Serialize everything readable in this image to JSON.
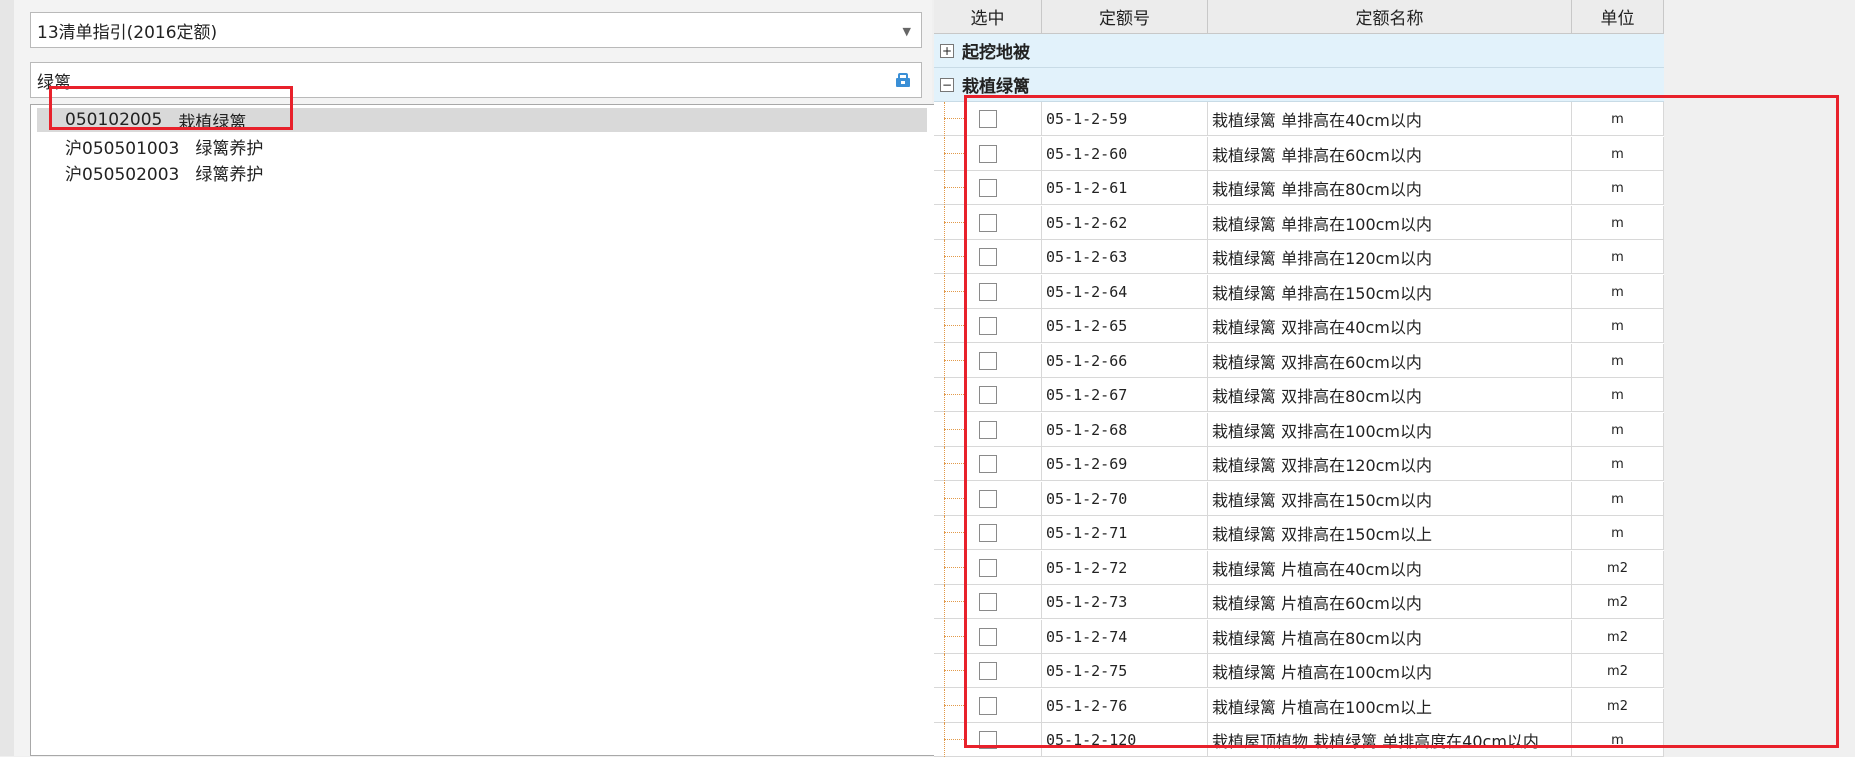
{
  "left": {
    "combo_value": "13清单指引(2016定额)",
    "search_value": "绿篱",
    "tree": [
      {
        "code": "050102005",
        "name": "栽植绿篱"
      },
      {
        "code": "沪050501003",
        "name": "绿篱养护"
      },
      {
        "code": "沪050502003",
        "name": "绿篱养护"
      }
    ]
  },
  "grid": {
    "headers": {
      "select": "选中",
      "code": "定额号",
      "name": "定额名称",
      "unit": "单位"
    },
    "groups": {
      "g1": {
        "toggle": "+",
        "label": "起挖地被"
      },
      "g2": {
        "toggle": "−",
        "label": "栽植绿篱"
      }
    },
    "rows": [
      {
        "code": "05-1-2-59",
        "name": "栽植绿篱 单排高在40cm以内",
        "unit": "m"
      },
      {
        "code": "05-1-2-60",
        "name": "栽植绿篱 单排高在60cm以内",
        "unit": "m"
      },
      {
        "code": "05-1-2-61",
        "name": "栽植绿篱 单排高在80cm以内",
        "unit": "m"
      },
      {
        "code": "05-1-2-62",
        "name": "栽植绿篱 单排高在100cm以内",
        "unit": "m"
      },
      {
        "code": "05-1-2-63",
        "name": "栽植绿篱 单排高在120cm以内",
        "unit": "m"
      },
      {
        "code": "05-1-2-64",
        "name": "栽植绿篱 单排高在150cm以内",
        "unit": "m"
      },
      {
        "code": "05-1-2-65",
        "name": "栽植绿篱 双排高在40cm以内",
        "unit": "m"
      },
      {
        "code": "05-1-2-66",
        "name": "栽植绿篱 双排高在60cm以内",
        "unit": "m"
      },
      {
        "code": "05-1-2-67",
        "name": "栽植绿篱 双排高在80cm以内",
        "unit": "m"
      },
      {
        "code": "05-1-2-68",
        "name": "栽植绿篱 双排高在100cm以内",
        "unit": "m"
      },
      {
        "code": "05-1-2-69",
        "name": "栽植绿篱 双排高在120cm以内",
        "unit": "m"
      },
      {
        "code": "05-1-2-70",
        "name": "栽植绿篱 双排高在150cm以内",
        "unit": "m"
      },
      {
        "code": "05-1-2-71",
        "name": "栽植绿篱 双排高在150cm以上",
        "unit": "m"
      },
      {
        "code": "05-1-2-72",
        "name": "栽植绿篱 片植高在40cm以内",
        "unit": "m2"
      },
      {
        "code": "05-1-2-73",
        "name": "栽植绿篱 片植高在60cm以内",
        "unit": "m2"
      },
      {
        "code": "05-1-2-74",
        "name": "栽植绿篱 片植高在80cm以内",
        "unit": "m2"
      },
      {
        "code": "05-1-2-75",
        "name": "栽植绿篱 片植高在100cm以内",
        "unit": "m2"
      },
      {
        "code": "05-1-2-76",
        "name": "栽植绿篱 片植高在100cm以上",
        "unit": "m2"
      },
      {
        "code": "05-1-2-120",
        "name": "栽植屋顶植物 栽植绿篱 单排高度在40cm以内",
        "unit": "m"
      }
    ]
  },
  "colors": {
    "highlight": "#e8212b",
    "group_bg": "#e2f2fb",
    "tree_line": "#e29a4a"
  },
  "icons": {
    "search_box_icon": "clear-filter-icon"
  }
}
